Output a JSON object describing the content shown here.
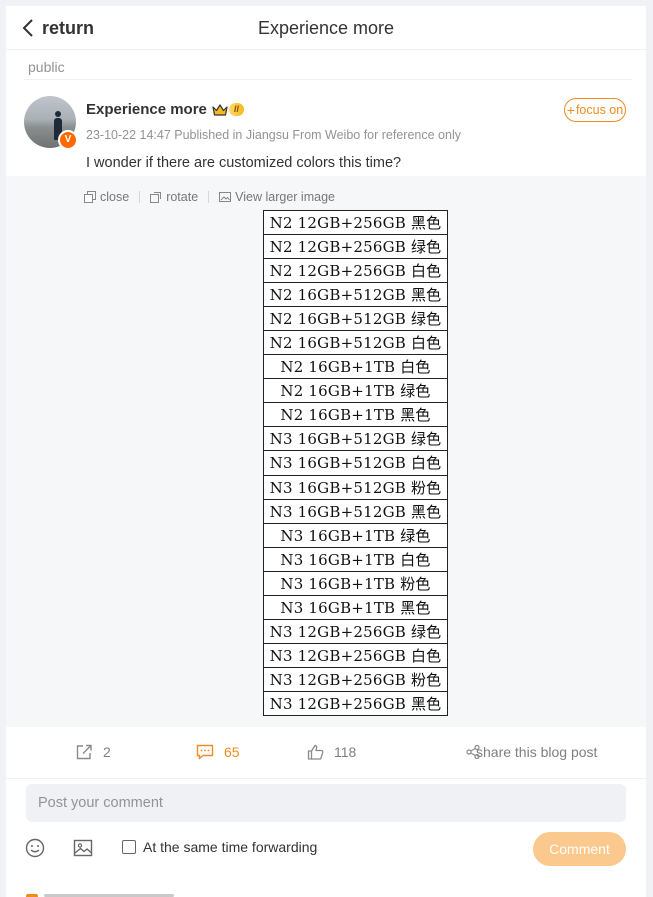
{
  "header": {
    "back_label": "return",
    "title": "Experience more"
  },
  "visibility": "public",
  "post": {
    "author": "Experience more",
    "author_level": "II",
    "verified_mark": "V",
    "meta": "23-10-22 14:47  Published in Jiangsu  From Weibo for reference only",
    "follow_label": "focus on",
    "follow_plus": "+",
    "text": "I wonder if there are customized colors this time?"
  },
  "media": {
    "tools": {
      "close": "close",
      "rotate": "rotate",
      "view_larger": "View larger image"
    },
    "table_rows": [
      "N2 12GB+256GB 黑色",
      "N2 12GB+256GB 绿色",
      "N2 12GB+256GB 白色",
      "N2 16GB+512GB 黑色",
      "N2 16GB+512GB 绿色",
      "N2 16GB+512GB 白色",
      "N2 16GB+1TB 白色",
      "N2 16GB+1TB 绿色",
      "N2 16GB+1TB 黑色",
      "N3 16GB+512GB 绿色",
      "N3 16GB+512GB 白色",
      "N3 16GB+512GB 粉色",
      "N3 16GB+512GB 黑色",
      "N3 16GB+1TB 绿色",
      "N3 16GB+1TB 白色",
      "N3 16GB+1TB 粉色",
      "N3 16GB+1TB 黑色",
      "N3 12GB+256GB 绿色",
      "N3 12GB+256GB 白色",
      "N3 12GB+256GB 粉色",
      "N3 12GB+256GB 黑色"
    ]
  },
  "actions": {
    "repost_count": "2",
    "comment_count": "65",
    "like_count": "118",
    "share_label": "share this blog post"
  },
  "composer": {
    "placeholder": "Post your comment",
    "forward_label": "At the same time forwarding",
    "submit_label": "Comment"
  },
  "colors": {
    "accent": "#f08b1f",
    "submit_bg": "#fbc88d",
    "muted": "#939393"
  },
  "icons": [
    "chevron-left-icon",
    "crown-icon",
    "copy-icon",
    "rotate-icon",
    "image-icon",
    "repost-icon",
    "comment-icon",
    "like-icon",
    "share-icon",
    "emoji-icon",
    "picture-icon"
  ]
}
